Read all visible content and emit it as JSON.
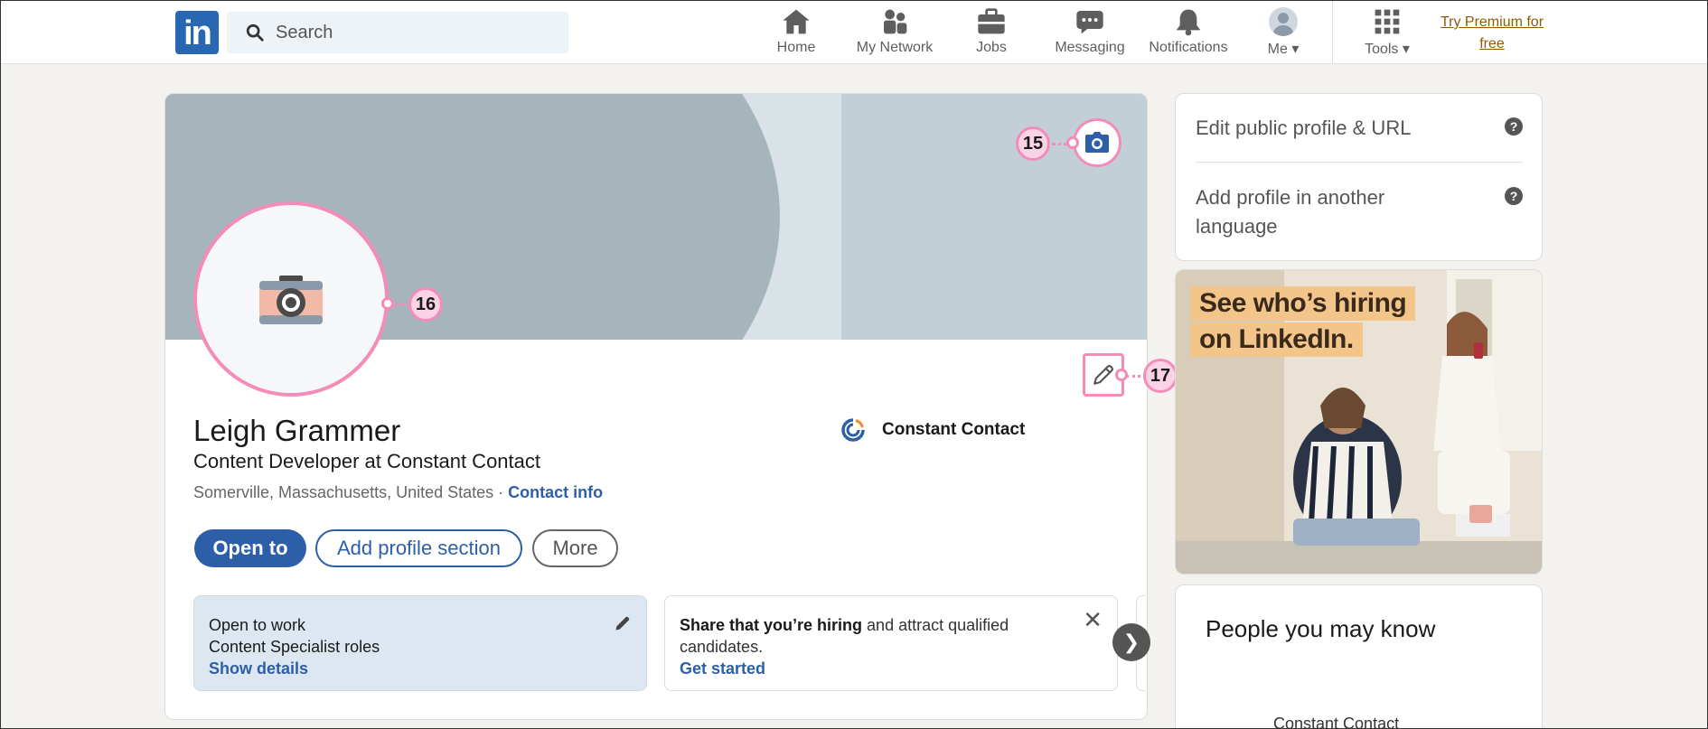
{
  "nav": {
    "search_placeholder": "Search",
    "items": [
      {
        "label": "Home",
        "icon": "home-icon"
      },
      {
        "label": "My Network",
        "icon": "network-icon"
      },
      {
        "label": "Jobs",
        "icon": "briefcase-icon"
      },
      {
        "label": "Messaging",
        "icon": "chat-icon"
      },
      {
        "label": "Notifications",
        "icon": "bell-icon"
      },
      {
        "label": "Me",
        "icon": "avatar"
      },
      {
        "label": "Tools",
        "icon": "grid-icon"
      }
    ],
    "premium_line1": "Try Premium for",
    "premium_line2": "free"
  },
  "profile": {
    "name": "Leigh Grammer",
    "headline": "Content Developer at Constant Contact",
    "location": "Somerville, Massachusetts, United States",
    "separator": "·",
    "contact_link": "Contact info",
    "company": "Constant Contact"
  },
  "actions": {
    "open_to": "Open to",
    "add_section": "Add profile section",
    "more": "More"
  },
  "open_to_work": {
    "title": "Open to work",
    "roles": "Content Specialist roles",
    "link": "Show details"
  },
  "hiring": {
    "bold": "Share that you’re hiring",
    "rest": " and attract qualified",
    "line2": "candidates.",
    "link": "Get started",
    "close": "✕"
  },
  "next": "❯",
  "annotations": {
    "cover": "15",
    "photo": "16",
    "edit": "17"
  },
  "sidebar": {
    "edit_profile": "Edit public profile & URL",
    "add_language_1": "Add profile in another",
    "add_language_2": "language",
    "help": "?"
  },
  "ad": {
    "line1": "See who’s hiring",
    "line2": "on LinkedIn."
  },
  "pymk": {
    "title": "People you may know",
    "partial": "Constant Contact"
  },
  "colors": {
    "brand": "#2867b2",
    "link": "#2d5fa8",
    "annotation": "#f48cb9",
    "premium": "#915907"
  }
}
